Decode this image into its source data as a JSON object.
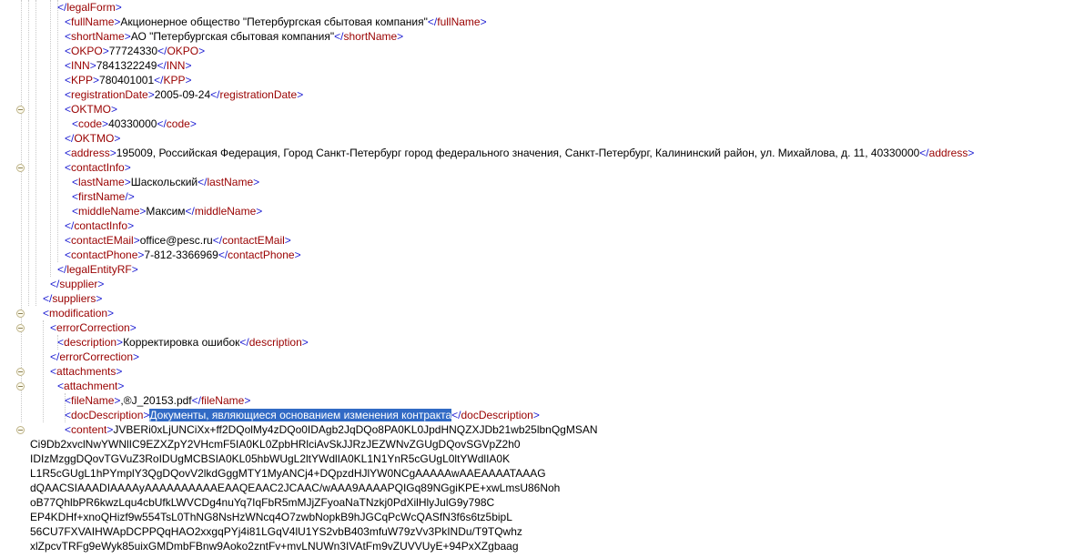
{
  "lines": [
    {
      "indent": 63,
      "close": "legalForm"
    },
    {
      "indent": 71,
      "tag": "fullName",
      "text": "Акционерное общество \"Петербургская сбытовая компания\""
    },
    {
      "indent": 71,
      "tag": "shortName",
      "text": "АО \"Петербургская сбытовая компания\""
    },
    {
      "indent": 71,
      "tag": "OKPO",
      "text": "77724330"
    },
    {
      "indent": 71,
      "tag": "INN",
      "text": "7841322249"
    },
    {
      "indent": 71,
      "tag": "KPP",
      "text": "780401001"
    },
    {
      "indent": 71,
      "tag": "registrationDate",
      "text": "2005-09-24"
    },
    {
      "indent": 71,
      "open": "OKTMO",
      "fold": true
    },
    {
      "indent": 79,
      "tag": "code",
      "text": "40330000"
    },
    {
      "indent": 71,
      "close": "OKTMO"
    },
    {
      "indent": 71,
      "tag": "address",
      "text": "195009, Российская Федерация, Город Санкт-Петербург город федерального значения, Санкт-Петербург, Калининский район, ул. Михайлова, д. 11, 40330000"
    },
    {
      "indent": 71,
      "open": "contactInfo",
      "fold": true
    },
    {
      "indent": 79,
      "tag": "lastName",
      "text": "Шаскольский"
    },
    {
      "indent": 79,
      "selfclose": "firstName"
    },
    {
      "indent": 79,
      "tag": "middleName",
      "text": "Максим"
    },
    {
      "indent": 71,
      "close": "contactInfo"
    },
    {
      "indent": 71,
      "tag": "contactEMail",
      "text": "office@pesc.ru"
    },
    {
      "indent": 71,
      "tag": "contactPhone",
      "text": "7-812-3366969"
    },
    {
      "indent": 63,
      "close": "legalEntityRF"
    },
    {
      "indent": 55,
      "close": "supplier"
    },
    {
      "indent": 47,
      "close": "suppliers"
    },
    {
      "indent": 47,
      "open": "modification",
      "fold": true
    },
    {
      "indent": 55,
      "open": "errorCorrection",
      "fold": true
    },
    {
      "indent": 63,
      "tag": "description",
      "text": "Корректировка ошибок"
    },
    {
      "indent": 55,
      "close": "errorCorrection"
    },
    {
      "indent": 55,
      "open": "attachments",
      "fold": true
    },
    {
      "indent": 63,
      "open": "attachment",
      "fold": true
    },
    {
      "indent": 71,
      "tag": "fileName",
      "text": ",®J_20153.pdf"
    },
    {
      "indent": 71,
      "tag": "docDescription",
      "text": "Документы, являющиеся основанием изменения контракта",
      "selected": true
    },
    {
      "indent": 71,
      "opentext": "content",
      "text": "JVBERi0xLjUNCiXx+ff2DQolMy4zDQo0IDAgb2JqDQo8PA0KL0JpdHNQZXJDb21wb25lbnQgMSAN",
      "fold": true
    }
  ],
  "base64": [
    "Ci9Db2xvclNwYWNlIC9EZXZpY2VHcmF5IA0KL0ZpbHRlciAvSkJJRzJEZWNvZGUgDQovSGVpZ2h0",
    "IDIzMzggDQovTGVuZ3RoIDUgMCBSIA0KL05hbWUgL2ltYWdlIA0KL1N1YnR5cGUgL0ltYWdlIA0K",
    "L1R5cGUgL1hPYmplY3QgDQovV2lkdGggMTY1MyANCj4+DQpzdHJlYW0NCgAAAAAwAAEAAAATAAAG",
    "dQAACSIAAADIAAAAyAAAAAAAAAAEAAQEAAC2JCAAC/wAAA9AAAAPQIGq89NGgiKPE+xwLmsU86Noh",
    "oB77QhlbPR6kwzLqu4cbUfkLWVCDg4nuYq7IqFbR5mMJjZFyoaNaTNzkj0PdXilHlyJulG9y798C",
    "EP4KDHf+xnoQHizf9w554TsL0ThNG8NsHzWNcq4O7zwbNopkB9hJGCqPcWcQASfN3f6s6tz5bipL",
    "56CU7FXVAIHWApDCPPQqHAO2xxgqPYj4i81LGqV4lU1YS2vbB403mfuW79zVv3PkINDu/T9TQwhz",
    "xlZpcvTRFg9eWyk85uixGMDmbFBnw9Aoko2zntFv+mvLNUWn3IVAtFm9vZUVVUyE+94PxXZgbaag"
  ]
}
